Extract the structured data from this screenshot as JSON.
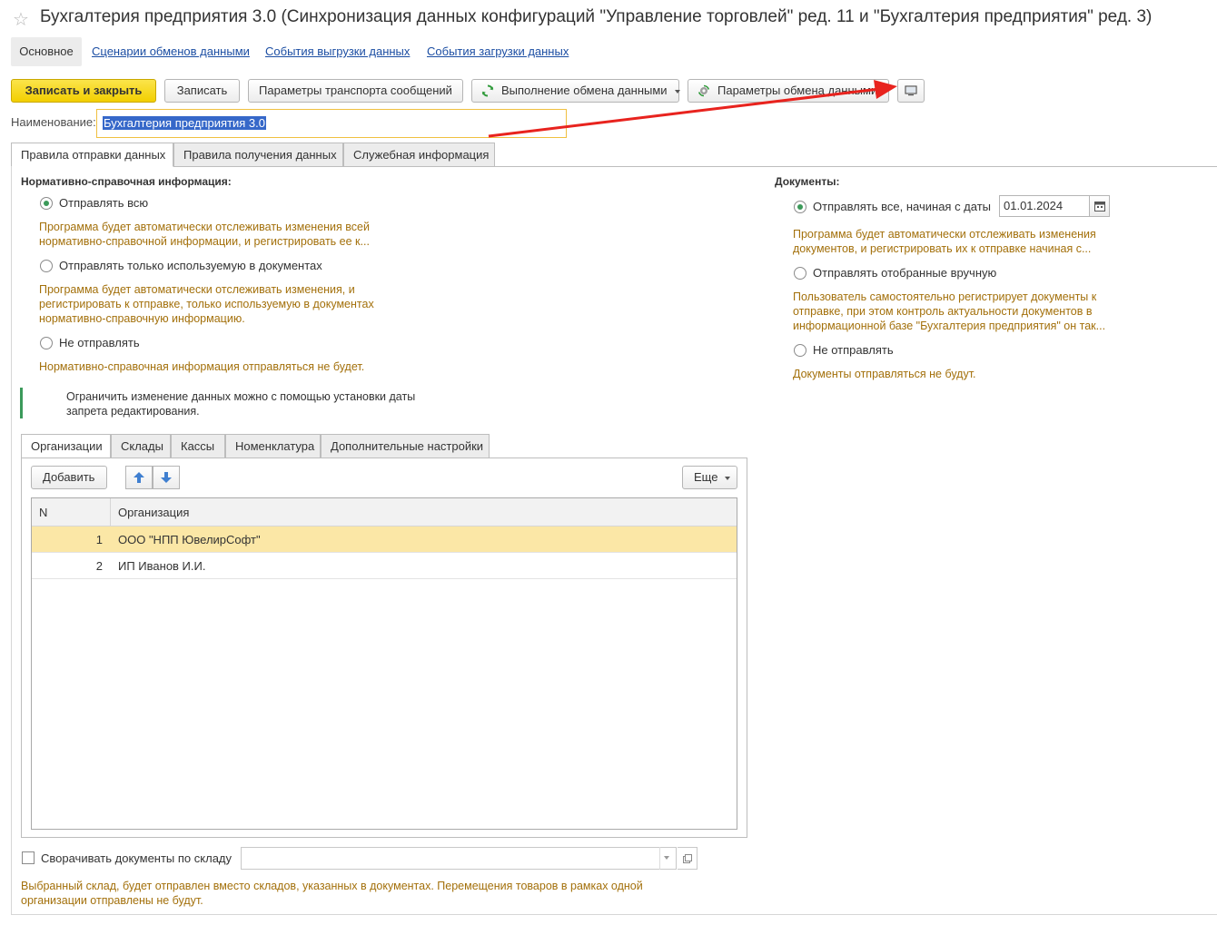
{
  "window": {
    "title": "Бухгалтерия предприятия 3.0 (Синхронизация данных конфигураций \"Управление торговлей\" ред. 11 и \"Бухгалтерия предприятия\" ред. 3)"
  },
  "nav": {
    "items": [
      "Основное",
      "Сценарии обменов данными",
      "События выгрузки данных",
      "События загрузки данных"
    ]
  },
  "toolbar": {
    "save_close": "Записать и закрыть",
    "save": "Записать",
    "transport": "Параметры транспорта сообщений",
    "exec": "Выполнение обмена данными",
    "params": "Параметры обмена данными"
  },
  "name_field": {
    "label": "Наименование:",
    "value": "Бухгалтерия предприятия 3.0"
  },
  "tabs": [
    "Правила отправки данных",
    "Правила получения данных",
    "Служебная информация"
  ],
  "nsi": {
    "title": "Нормативно-справочная информация:",
    "opt1": "Отправлять всю",
    "hint1a": "Программа будет автоматически отслеживать изменения всей",
    "hint1b": "нормативно-справочной информации, и регистрировать ее к...",
    "opt2": "Отправлять только используемую в документах",
    "hint2a": "Программа будет автоматически отслеживать изменения, и",
    "hint2b": "регистрировать к отправке, только используемую в документах",
    "hint2c": "нормативно-справочную информацию.",
    "opt3": "Не отправлять",
    "hint3": "Нормативно-справочная информация отправляться не будет."
  },
  "info": {
    "line1": "Ограничить изменение данных можно с помощью установки даты",
    "line2": "запрета редактирования."
  },
  "docs": {
    "title": "Документы:",
    "opt1": "Отправлять все, начиная с даты",
    "date": "01.01.2024",
    "hint1a": "Программа будет автоматически отслеживать изменения",
    "hint1b": "документов, и регистрировать их к отправке начиная с...",
    "opt2": "Отправлять отобранные вручную",
    "hint2a": "Пользователь самостоятельно регистрирует документы к",
    "hint2b": "отправке, при этом контроль актуальности документов в",
    "hint2c": "информационной базе \"Бухгалтерия предприятия\" он так...",
    "opt3": "Не отправлять",
    "hint3": "Документы отправляться не будут."
  },
  "subtabs": [
    "Организации",
    "Склады",
    "Кассы",
    "Номенклатура",
    "Дополнительные настройки"
  ],
  "table_toolbar": {
    "add": "Добавить",
    "more": "Еще"
  },
  "grid": {
    "columns": [
      "N",
      "Организация"
    ],
    "rows": [
      {
        "n": "1",
        "org": "ООО \"НПП ЮвелирСофт\""
      },
      {
        "n": "2",
        "org": "ИП Иванов И.И."
      }
    ]
  },
  "collapse": {
    "label": "Сворачивать документы по складу",
    "hint1": "Выбранный склад, будет отправлен  вместо складов, указанных в документах. Перемещения товаров в рамках одной",
    "hint2": "организации отправлены не будут."
  },
  "colors": {
    "accent": "#f2cf00",
    "link": "#1c4ea3",
    "hint": "#a3700b",
    "annotation": "#e8231e"
  }
}
